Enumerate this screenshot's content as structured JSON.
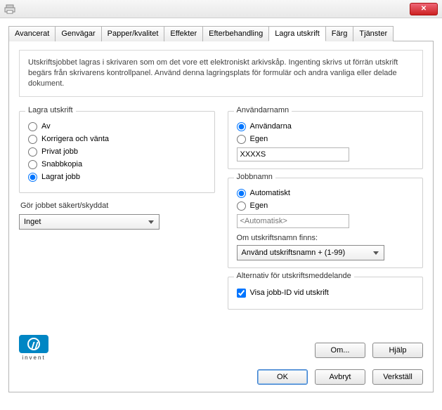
{
  "window": {
    "close_glyph": "✕"
  },
  "tabs": {
    "items": [
      {
        "label": "Avancerat"
      },
      {
        "label": "Genvägar"
      },
      {
        "label": "Papper/kvalitet"
      },
      {
        "label": "Effekter"
      },
      {
        "label": "Efterbehandling"
      },
      {
        "label": "Lagra utskrift"
      },
      {
        "label": "Färg"
      },
      {
        "label": "Tjänster"
      }
    ],
    "active_index": 5
  },
  "description": "Utskriftsjobbet lagras i skrivaren som om det vore ett elektroniskt arkivskåp. Ingenting skrivs ut förrän utskrift begärs från skrivarens kontrollpanel. Använd denna lagringsplats för formulär och andra vanliga eller delade dokument.",
  "store_print": {
    "title": "Lagra utskrift",
    "options": {
      "off": "Av",
      "proof": "Korrigera och vänta",
      "private": "Privat jobb",
      "quick": "Snabbkopia",
      "stored": "Lagrat jobb"
    },
    "selected": "stored"
  },
  "secure": {
    "title": "Gör jobbet säkert/skyddat",
    "select_value": "Inget"
  },
  "username": {
    "title": "Användarnamn",
    "options": {
      "auto": "Användarna",
      "custom": "Egen"
    },
    "selected": "auto",
    "field_value": "XXXXS"
  },
  "jobname": {
    "title": "Jobbnamn",
    "options": {
      "auto": "Automatiskt",
      "custom": "Egen"
    },
    "selected": "auto",
    "field_value": "<Automatisk>",
    "exists_label": "Om utskriftsnamn finns:",
    "exists_value": "Använd utskriftsnamn + (1-99)"
  },
  "notify": {
    "title": "Alternativ för utskriftsmeddelande",
    "check_label": "Visa jobb-ID vid utskrift",
    "checked": true
  },
  "logo": {
    "text": "invent"
  },
  "buttons": {
    "about": "Om...",
    "help": "Hjälp",
    "ok": "OK",
    "cancel": "Avbryt",
    "apply": "Verkställ"
  }
}
